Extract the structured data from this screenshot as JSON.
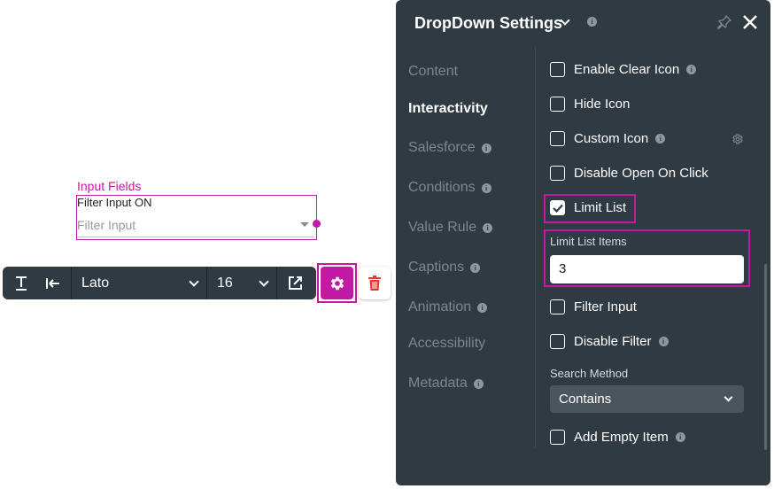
{
  "canvas": {
    "section_label": "Input Fields",
    "field_caption": "Filter Input ON",
    "field_placeholder": "Filter Input"
  },
  "toolbar": {
    "font_family": "Lato",
    "font_size": "16",
    "icons": [
      "text-underline-icon",
      "align-left-icon",
      "external-link-icon",
      "gear-icon",
      "trash-icon"
    ]
  },
  "panel": {
    "title": "DropDown Settings",
    "nav": [
      {
        "label": "Content",
        "info": false,
        "active": false
      },
      {
        "label": "Interactivity",
        "info": false,
        "active": true
      },
      {
        "label": "Salesforce",
        "info": true,
        "active": false
      },
      {
        "label": "Conditions",
        "info": true,
        "active": false
      },
      {
        "label": "Value Rule",
        "info": true,
        "active": false
      },
      {
        "label": "Captions",
        "info": true,
        "active": false
      },
      {
        "label": "Animation",
        "info": true,
        "active": false
      },
      {
        "label": "Accessibility",
        "info": false,
        "active": false
      },
      {
        "label": "Metadata",
        "info": true,
        "active": false
      }
    ],
    "options": [
      {
        "label": "Enable Clear Icon",
        "checked": false,
        "info": true
      },
      {
        "label": "Hide Icon",
        "checked": false,
        "info": false
      },
      {
        "label": "Custom Icon",
        "checked": false,
        "info": true
      },
      {
        "label": "Disable Open On Click",
        "checked": false,
        "info": false
      },
      {
        "label": "Limit List",
        "checked": true,
        "info": false
      },
      {
        "label": "Filter Input",
        "checked": false,
        "info": false
      },
      {
        "label": "Disable Filter",
        "checked": false,
        "info": true
      },
      {
        "label": "Add Empty Item",
        "checked": false,
        "info": true
      }
    ],
    "limit_list_items_label": "Limit List Items",
    "limit_list_items_value": "3",
    "search_method_label": "Search Method",
    "search_method_value": "Contains",
    "info_glyph": "i"
  },
  "colors": {
    "accent": "#c31aa5",
    "panel_bg": "#2f3a42",
    "toolbar_bg": "#2f3a42",
    "muted_nav": "#7d878d",
    "delete_red": "#e53935"
  }
}
